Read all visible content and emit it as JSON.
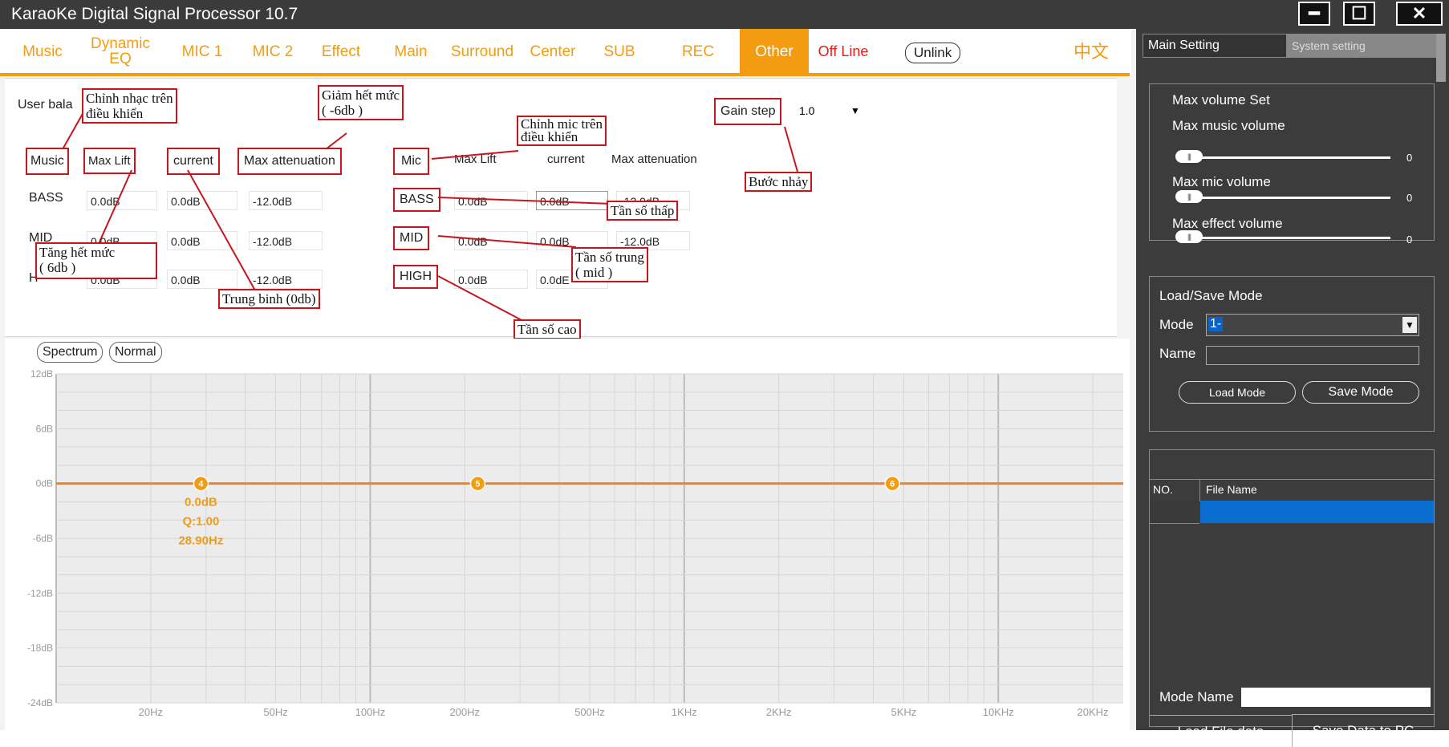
{
  "window": {
    "title": "KaraoKe Digital Signal Processor 10.7",
    "controls": {
      "minimize": "━",
      "maximize": "☐",
      "close": "✕"
    }
  },
  "tabs": [
    {
      "label": "Music"
    },
    {
      "label": "Dynamic\nEQ"
    },
    {
      "label": "MIC 1"
    },
    {
      "label": "MIC 2"
    },
    {
      "label": "Effect"
    },
    {
      "label": "Main"
    },
    {
      "label": "Surround"
    },
    {
      "label": "Center"
    },
    {
      "label": "SUB"
    },
    {
      "label": "REC"
    },
    {
      "label": "Other",
      "active": true
    }
  ],
  "status": {
    "offline": "Off Line",
    "unlink": "Unlink",
    "language": "中文"
  },
  "balance": {
    "user_label": "User bala",
    "music": {
      "header": {
        "name": "Music",
        "max_lift": "Max Lift",
        "current": "current",
        "max_attenuation": "Max attenuation"
      },
      "rows": [
        {
          "name": "BASS",
          "max_lift": "0.0dB",
          "current": "0.0dB",
          "max_attenuation": "-12.0dB"
        },
        {
          "name": "MID",
          "max_lift": "0.0dB",
          "current": "0.0dB",
          "max_attenuation": "-12.0dB"
        },
        {
          "name": "H",
          "max_lift": "0.0dB",
          "current": "0.0dB",
          "max_attenuation": "-12.0dB"
        }
      ]
    },
    "mic": {
      "header": {
        "name": "Mic",
        "max_lift": "Max Lift",
        "current": "current",
        "max_attenuation": "Max attenuation"
      },
      "rows": [
        {
          "name": "BASS",
          "max_lift": "0.0dB",
          "current": "0.0dB",
          "max_attenuation": "-12.0dB"
        },
        {
          "name": "MID",
          "max_lift": "0.0dB",
          "current": "0.0dB",
          "max_attenuation": "-12.0dB"
        },
        {
          "name": "HIGH",
          "max_lift": "0.0dB",
          "current": "0.0dE",
          "max_attenuation": ""
        }
      ]
    },
    "gain_step": {
      "label": "Gain step",
      "value": "1.0"
    }
  },
  "annotations": {
    "music_control": "Chỉnh nhạc trên\nđiều khiển",
    "max_attenuation_note": "Giảm hết mức\n( -6db )",
    "mic_control": "Chỉnh mic trên\nđiều khiển",
    "step_note": "Bước nhảy",
    "bass_note": "Tần số thấp",
    "mid_note": "Tần số trung\n( mid )",
    "high_note": "Tần số cao",
    "max_lift_note": "Tăng hết mức\n( 6db )",
    "current_note": "Trung binh (0db)"
  },
  "eq": {
    "mode_buttons": {
      "spectrum": "Spectrum",
      "normal": "Normal"
    },
    "selected_point": {
      "gain": "0.0dB",
      "q": "Q:1.00",
      "freq": "28.90Hz"
    }
  },
  "chart_data": {
    "type": "line",
    "y_ticks": [
      "12dB",
      "6dB",
      "0dB",
      "-6dB",
      "-12dB",
      "-18dB",
      "-24dB"
    ],
    "ylim": [
      -24,
      12
    ],
    "x_ticks": [
      "20Hz",
      "50Hz",
      "100Hz",
      "200Hz",
      "500Hz",
      "1KHz",
      "2KHz",
      "5KHz",
      "10KHz",
      "20KHz"
    ],
    "x_tick_values": [
      20,
      50,
      100,
      200,
      500,
      1000,
      2000,
      5000,
      10000,
      20000
    ],
    "xlim": [
      10,
      25000
    ],
    "x_scale": "log",
    "grid": true,
    "series": [
      {
        "x": [
          10,
          25000
        ],
        "y": [
          0,
          0
        ]
      }
    ],
    "points": [
      {
        "label": "4",
        "freq": 28.9,
        "gain": 0
      },
      {
        "label": "5",
        "freq": 220,
        "gain": 0
      },
      {
        "label": "6",
        "freq": 4600,
        "gain": 0
      }
    ],
    "line_color": "#f0822a",
    "point_color": "#f39c12"
  },
  "right": {
    "tabs": {
      "main": "Main Setting",
      "system": "System setting"
    },
    "max_volume": {
      "title": "Max volume Set",
      "items": [
        {
          "label": "Max music volume",
          "value": "0"
        },
        {
          "label": "Max mic volume",
          "value": "0"
        },
        {
          "label": "Max effect volume",
          "value": "0"
        }
      ]
    },
    "load_save": {
      "title": "Load/Save Mode",
      "mode_label": "Mode",
      "mode_value": "1-",
      "name_label": "Name",
      "name_value": "",
      "load_btn": "Load Mode",
      "save_btn": "Save Mode"
    },
    "file_table": {
      "col_no": "NO.",
      "col_name": "File Name",
      "mode_name_label": "Mode Name",
      "mode_name_value": "",
      "load_btn": "Load File data",
      "save_btn": "Save Data to PC"
    }
  }
}
